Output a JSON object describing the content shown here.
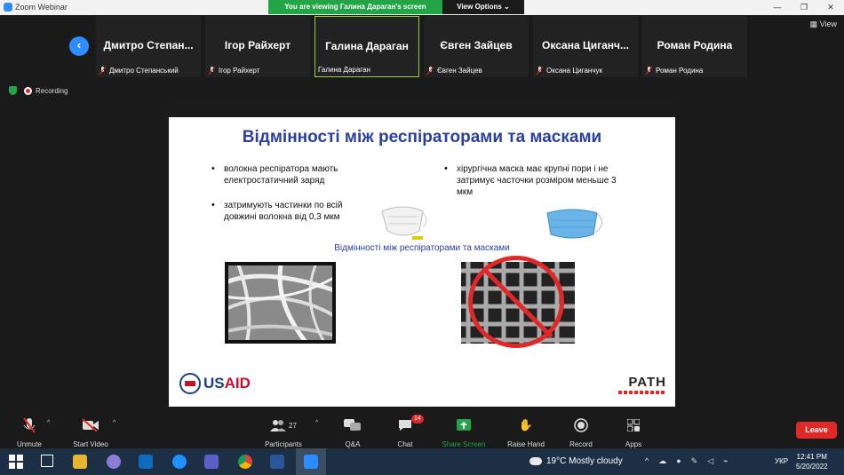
{
  "window": {
    "title": "Zoom Webinar",
    "controls": [
      "—",
      "❐",
      "✕"
    ]
  },
  "share_banner": {
    "text": "You are viewing Галина Дараган's screen",
    "view_options": "View Options ⌄"
  },
  "view_button": "▦ View",
  "participants": [
    {
      "name": "Дмитро  Степан...",
      "label": "Дмитро Степанський"
    },
    {
      "name": "Ігор Райхерт",
      "label": "Ігор Райхерт"
    },
    {
      "name": "Галина Дараган",
      "label": "Галина Дараган"
    },
    {
      "name": "Євген Зайцев",
      "label": "Євген Зайцев"
    },
    {
      "name": "Оксана  Циганч...",
      "label": "Оксана Циганчук"
    },
    {
      "name": "Роман Родина",
      "label": "Роман Родина"
    }
  ],
  "status": {
    "recording": "Recording"
  },
  "slide": {
    "title": "Відмінності між респіраторами та масками",
    "bullets_left": [
      "волокна респіратора мають електростатичний заряд",
      "затримують частинки по всій довжині волокна від 0,3 мкм"
    ],
    "bullet_right": "хірургічна маска має крупні пори і не затримує часточки розміром меньше 3 мкм",
    "subtitle": "Відмінності між респіраторами та масками",
    "usaid": {
      "us": "US",
      "aid": "AID"
    },
    "path": "PATH"
  },
  "toolbar": {
    "unmute": "Unmute",
    "start_video": "Start Video",
    "participants_label": "Participants",
    "participants_count": "27",
    "qa": "Q&A",
    "chat": "Chat",
    "chat_badge": "14",
    "share_screen": "Share Screen",
    "raise_hand": "Raise Hand",
    "record": "Record",
    "apps": "Apps",
    "leave": "Leave"
  },
  "taskbar": {
    "weather": "19°C  Mostly cloudy",
    "lang": "УКР",
    "time": "12:41 PM",
    "date": "5/20/2022"
  },
  "colors": {
    "accent": "#2d8cff",
    "share_green": "#23a446",
    "leave_red": "#e02828",
    "slide_title": "#2b3fa0"
  }
}
